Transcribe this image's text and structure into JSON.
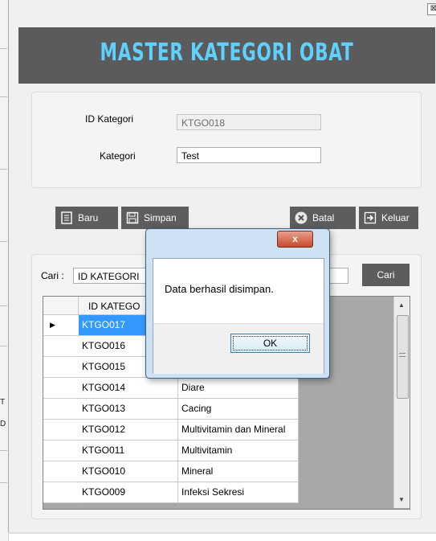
{
  "window": {
    "title": "MASTER KATEGORI OBAT",
    "close_glyph": "⊠"
  },
  "form": {
    "id_label": "ID Kategori",
    "id_value": "KTGO018",
    "kategori_label": "Kategori",
    "kategori_value": "Test"
  },
  "toolbar": {
    "baru": "Baru",
    "simpan": "Simpan",
    "batal": "Batal",
    "keluar": "Keluar"
  },
  "search": {
    "label": "Cari :",
    "select_value": "ID KATEGORI",
    "button": "Cari"
  },
  "grid": {
    "headers": [
      "ID KATEGO",
      ""
    ],
    "rows": [
      [
        "KTGO017",
        ""
      ],
      [
        "KTGO016",
        ""
      ],
      [
        "KTGO015",
        ""
      ],
      [
        "KTGO014",
        "Diare"
      ],
      [
        "KTGO013",
        "Cacing"
      ],
      [
        "KTGO012",
        "Multivitamin dan Mineral"
      ],
      [
        "KTGO011",
        "Multivitamin"
      ],
      [
        "KTGO010",
        "Mineral"
      ],
      [
        "KTGO009",
        "Infeksi Sekresi"
      ]
    ],
    "selected_index": 0
  },
  "dialog": {
    "close_glyph": "x",
    "message": "Data berhasil disimpan.",
    "ok_label": "OK"
  },
  "background": {
    "chars": [
      "T",
      "D"
    ]
  }
}
